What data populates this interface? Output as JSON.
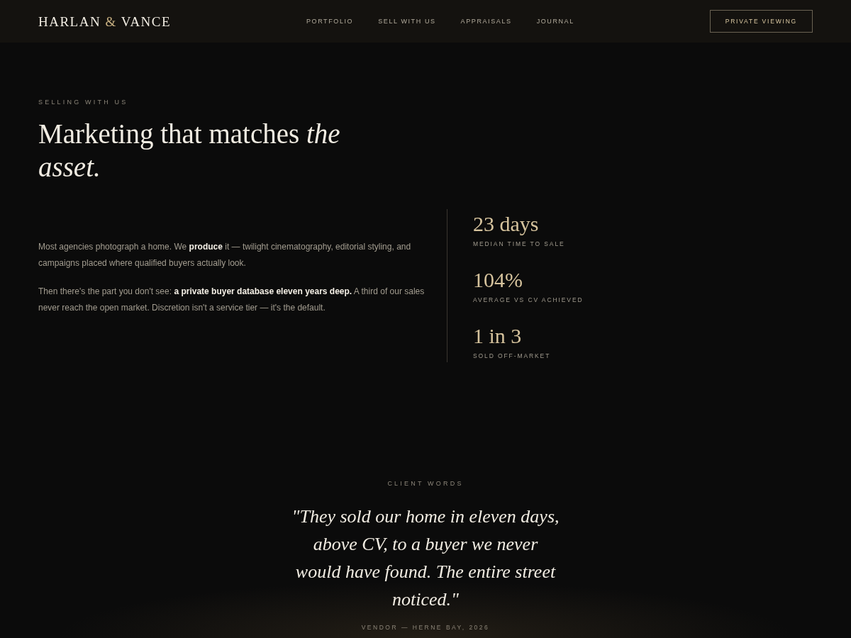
{
  "header": {
    "logo": [
      {
        "text": "HARLAN",
        "accent": false
      },
      {
        "text": "&",
        "accent": true
      },
      {
        "text": "VANCE",
        "accent": false
      }
    ],
    "nav": [
      "PORTFOLIO",
      "SELL WITH US",
      "APPRAISALS",
      "JOURNAL"
    ],
    "cta": "PRIVATE VIEWING"
  },
  "intro": {
    "eyebrow": "SELLING WITH US",
    "heading": "Marketing that matches *the asset.*",
    "paragraphs": [
      "Most agencies photograph a home. We **produce** it — twilight cinematography, editorial styling, and campaigns placed where qualified buyers actually look.",
      "Then there's the part you don't see: **a private buyer database eleven years deep.** A third of our sales never reach the open market. Discretion isn't a service tier — it's the default."
    ]
  },
  "stats": [
    {
      "value": "23 days",
      "label": "MEDIAN TIME TO SALE"
    },
    {
      "value": "104%",
      "label": "AVERAGE VS CV ACHIEVED"
    },
    {
      "value": "1 in 3",
      "label": "SOLD OFF-MARKET"
    }
  ],
  "testimonial": {
    "eyebrow": "CLIENT WORDS",
    "quote": "\"They sold our home in eleven days, above CV, to a buyer we never would have found. The entire street noticed.\"",
    "attribution": "VENDOR — HERNE BAY, 2026"
  }
}
